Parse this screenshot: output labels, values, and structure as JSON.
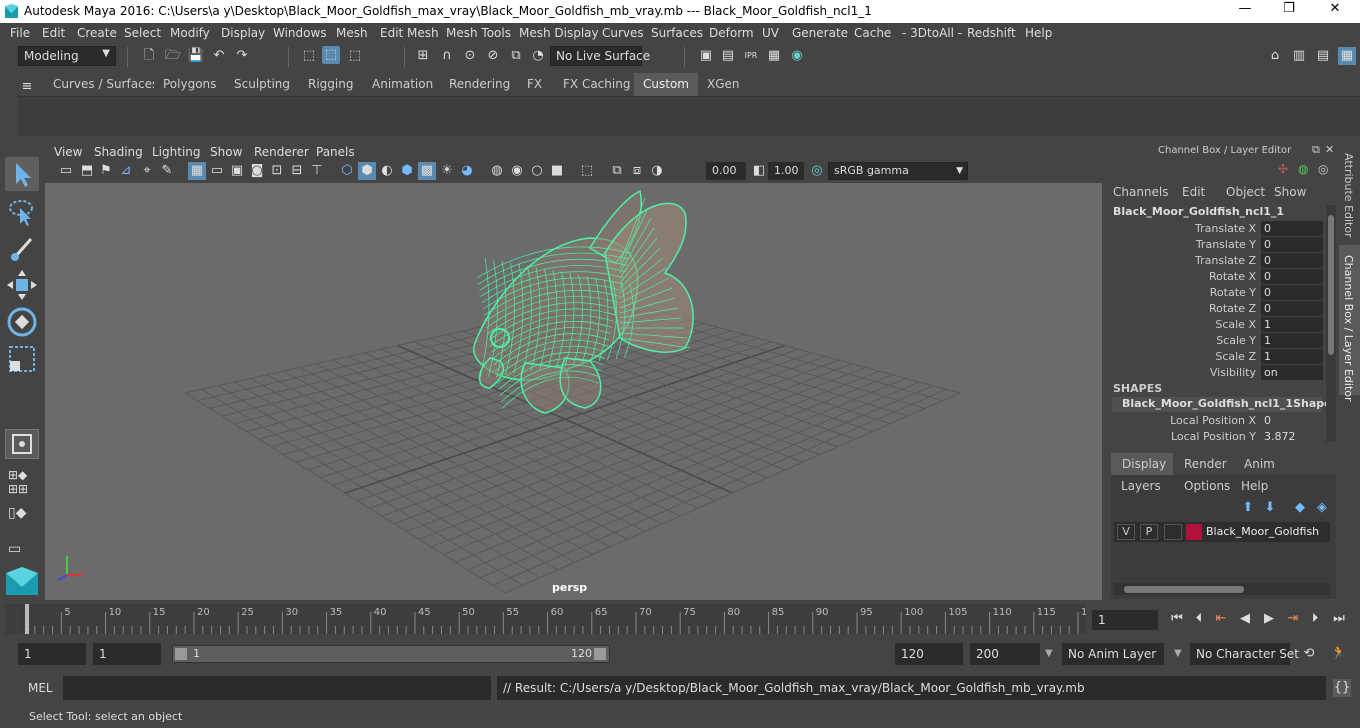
{
  "window": {
    "title": "Autodesk Maya 2016: C:\\Users\\a y\\Desktop\\Black_Moor_Goldfish_max_vray\\Black_Moor_Goldfish_mb_vray.mb   ---   Black_Moor_Goldfish_ncl1_1",
    "minimize": "—",
    "maximize": "❐",
    "close": "✕"
  },
  "menubar": [
    "File",
    "Edit",
    "Create",
    "Select",
    "Modify",
    "Display",
    "Windows",
    "Mesh",
    "Edit Mesh",
    "Mesh Tools",
    "Mesh Display",
    "Curves",
    "Surfaces",
    "Deform",
    "UV",
    "Generate",
    "Cache",
    "- 3DtoAll -",
    "Redshift",
    "Help"
  ],
  "toolbar": {
    "mode": "Modeling",
    "live_surface": "No Live Surface"
  },
  "shelf_tabs": [
    "Curves / Surfaces",
    "Polygons",
    "Sculpting",
    "Rigging",
    "Animation",
    "Rendering",
    "FX",
    "FX Caching",
    "Custom",
    "XGen"
  ],
  "shelf_active": "Custom",
  "viewport": {
    "menu": [
      "View",
      "Shading",
      "Lighting",
      "Show",
      "Renderer",
      "Panels"
    ],
    "exposure": "0.00",
    "gamma": "1.00",
    "color_space": "sRGB gamma",
    "camera_label": "persp",
    "wire_color": "#4ef0a6"
  },
  "channel_box": {
    "header": "Channel Box / Layer Editor",
    "menu": [
      "Channels",
      "Edit",
      "Object",
      "Show"
    ],
    "object": "Black_Moor_Goldfish_ncl1_1",
    "channels": [
      {
        "label": "Translate X",
        "value": "0"
      },
      {
        "label": "Translate Y",
        "value": "0"
      },
      {
        "label": "Translate Z",
        "value": "0"
      },
      {
        "label": "Rotate X",
        "value": "0"
      },
      {
        "label": "Rotate Y",
        "value": "0"
      },
      {
        "label": "Rotate Z",
        "value": "0"
      },
      {
        "label": "Scale X",
        "value": "1"
      },
      {
        "label": "Scale Y",
        "value": "1"
      },
      {
        "label": "Scale Z",
        "value": "1"
      },
      {
        "label": "Visibility",
        "value": "on"
      }
    ],
    "shapes_header": "SHAPES",
    "shape_name": "Black_Moor_Goldfish_ncl1_1Shape",
    "shape_channels": [
      {
        "label": "Local Position X",
        "value": "0"
      },
      {
        "label": "Local Position Y",
        "value": "3.872"
      }
    ]
  },
  "side_tabs": {
    "attribute_editor": "Attribute Editor",
    "channel_box": "Channel Box / Layer Editor"
  },
  "layer_editor": {
    "tabs": [
      "Display",
      "Render",
      "Anim"
    ],
    "active_tab": "Display",
    "menu": [
      "Layers",
      "Options",
      "Help"
    ],
    "layer": {
      "v": "V",
      "p": "P",
      "name": "Black_Moor_Goldfish",
      "color": "#b0123a"
    }
  },
  "timeline": {
    "ticks": [
      "1",
      "5",
      "10",
      "15",
      "20",
      "25",
      "30",
      "35",
      "40",
      "45",
      "50",
      "55",
      "60",
      "65",
      "70",
      "75",
      "80",
      "85",
      "90",
      "95",
      "100",
      "105",
      "110",
      "115",
      "12"
    ],
    "current_frame": "1"
  },
  "range": {
    "start": "1",
    "anim_start": "1",
    "range_start": "1",
    "range_end": "120",
    "end": "120",
    "anim_end": "200",
    "anim_layer": "No Anim Layer",
    "character_set": "No Character Set"
  },
  "command": {
    "label": "MEL",
    "result": "// Result: C:/Users/a y/Desktop/Black_Moor_Goldfish_max_vray/Black_Moor_Goldfish_mb_vray.mb"
  },
  "help_line": "Select Tool: select an object"
}
